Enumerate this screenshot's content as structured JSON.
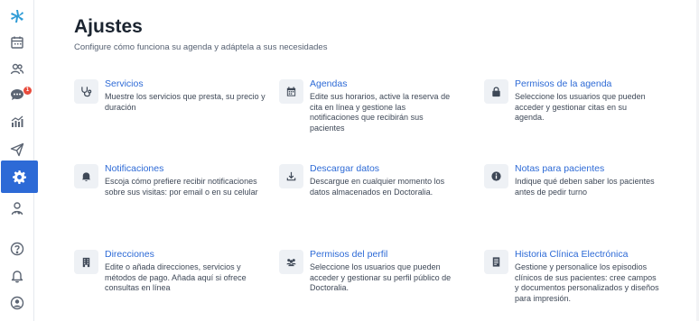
{
  "sidebar": {
    "items": [
      {
        "name": "logo",
        "icon": "star-cross-logo-icon"
      },
      {
        "name": "calendar",
        "icon": "calendar-icon"
      },
      {
        "name": "patients",
        "icon": "users-icon"
      },
      {
        "name": "messages",
        "icon": "chat-icon",
        "badge": "1"
      },
      {
        "name": "stats",
        "icon": "bar-chart-icon"
      },
      {
        "name": "campaigns",
        "icon": "paper-plane-icon"
      },
      {
        "name": "settings",
        "icon": "gear-icon",
        "active": true
      },
      {
        "name": "profile",
        "icon": "doctor-icon"
      },
      {
        "name": "help",
        "icon": "question-icon"
      },
      {
        "name": "notifications",
        "icon": "bell-icon"
      },
      {
        "name": "account",
        "icon": "account-icon"
      }
    ],
    "active_color": "#2d6ad6",
    "badge_color": "#e84b3c"
  },
  "header": {
    "title": "Ajustes",
    "subtitle": "Configure cómo funciona su agenda y adáptela a sus necesidades"
  },
  "cards": [
    {
      "title": "Servicios",
      "desc": "Muestre los servicios que presta, su precio y duración",
      "icon": "stethoscope-icon"
    },
    {
      "title": "Agendas",
      "desc": "Edite sus horarios, active la reserva de cita en línea y gestione las notificaciones que recibirán sus pacientes",
      "icon": "calendar-icon"
    },
    {
      "title": "Permisos de la agenda",
      "desc": "Seleccione los usuarios que pueden acceder y gestionar citas en su agenda.",
      "icon": "lock-icon"
    },
    {
      "title": "Notificaciones",
      "desc": "Escoja cómo prefiere recibir notificaciones sobre sus visitas: por email o en su celular",
      "icon": "bell-icon"
    },
    {
      "title": "Descargar datos",
      "desc": "Descargue en cualquier momento los datos almacenados en Doctoralia.",
      "icon": "download-icon"
    },
    {
      "title": "Notas para pacientes",
      "desc": "Indique qué deben saber los pacientes antes de pedir turno",
      "icon": "info-icon"
    },
    {
      "title": "Direcciones",
      "desc": "Edite o añada direcciones, servicios y métodos de pago. Añada aquí si ofrece consultas en línea",
      "icon": "building-icon"
    },
    {
      "title": "Permisos del perfil",
      "desc": "Seleccione los usuarios que pueden acceder y gestionar su perfil público de Doctoralia.",
      "icon": "group-icon"
    },
    {
      "title": "Historia Clínica Electrónica",
      "desc": "Gestione y personalice los episodios clínicos de sus pacientes: cree campos y documentos personalizados y diseños para impresión.",
      "icon": "document-icon"
    }
  ],
  "colors": {
    "link": "#2d6ad6",
    "icon_bg": "#eef1f5",
    "icon_fg": "#3e4857"
  }
}
